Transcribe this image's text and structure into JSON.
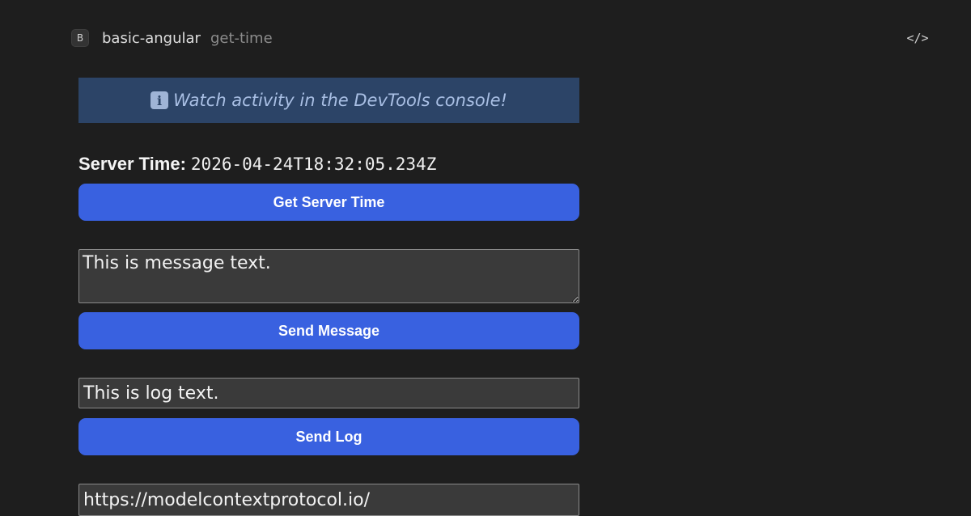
{
  "header": {
    "badge_letter": "B",
    "app_name": "basic-angular",
    "tool_name": "get-time",
    "code_icon": "code-icon"
  },
  "notice": {
    "icon": "info-icon",
    "icon_glyph": "i",
    "text": "Watch activity in the DevTools console!"
  },
  "server_time": {
    "label": "Server Time:",
    "value": "2026-04-24T18:32:05.234Z"
  },
  "buttons": {
    "get_server_time": "Get Server Time",
    "send_message": "Send Message",
    "send_log": "Send Log"
  },
  "inputs": {
    "message_value": "This is message text.",
    "log_value": "This is log text.",
    "url_value": "https://modelcontextprotocol.io/"
  },
  "colors": {
    "background": "#1e1e1e",
    "accent_button": "#3961e0",
    "notice_background": "#2c4467",
    "notice_text": "#a9bfe4"
  }
}
